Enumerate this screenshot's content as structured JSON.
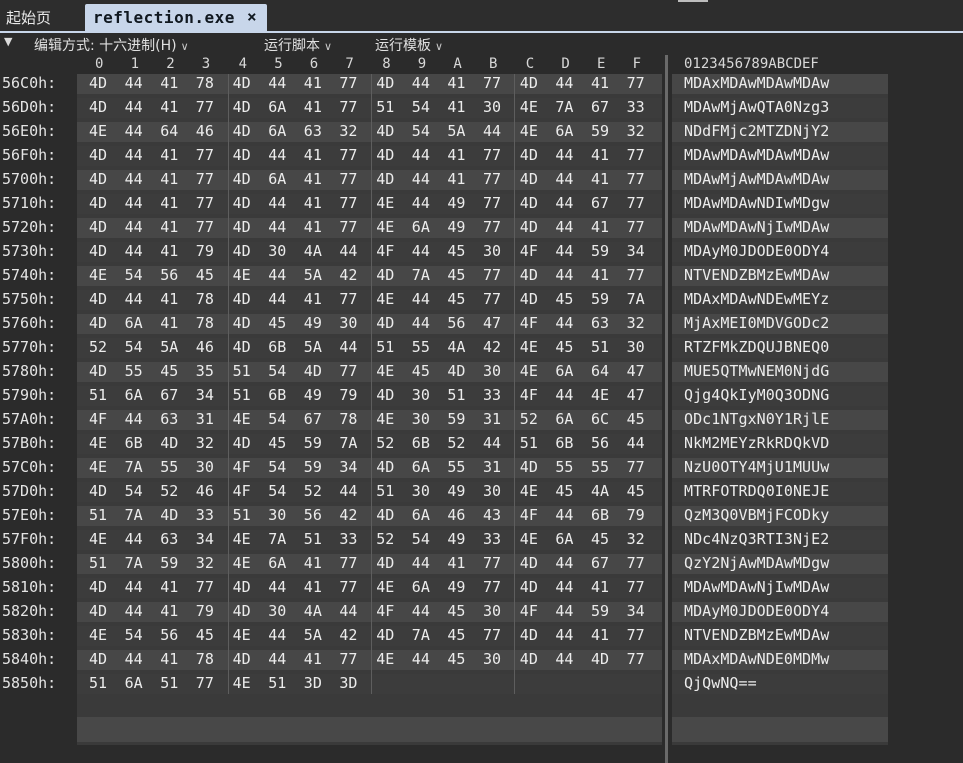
{
  "tabs": {
    "home_label": "起始页",
    "active_title": "reflection.exe",
    "close_glyph": "×"
  },
  "toolbar": {
    "collapse_glyph": "▼",
    "edit_mode_label": "编辑方式: 十六进制(H)",
    "run_script_label": "运行脚本",
    "run_template_label": "运行模板",
    "chevron_glyph": "∨"
  },
  "columns": {
    "hex_headers": [
      "0",
      "1",
      "2",
      "3",
      "4",
      "5",
      "6",
      "7",
      "8",
      "9",
      "A",
      "B",
      "C",
      "D",
      "E",
      "F"
    ],
    "ascii_header": "0123456789ABCDEF"
  },
  "rows": [
    {
      "addr": "56C0h:",
      "bytes": [
        "4D",
        "44",
        "41",
        "78",
        "4D",
        "44",
        "41",
        "77",
        "4D",
        "44",
        "41",
        "77",
        "4D",
        "44",
        "41",
        "77"
      ],
      "ascii": "MDAxMDAwMDAwMDAw"
    },
    {
      "addr": "56D0h:",
      "bytes": [
        "4D",
        "44",
        "41",
        "77",
        "4D",
        "6A",
        "41",
        "77",
        "51",
        "54",
        "41",
        "30",
        "4E",
        "7A",
        "67",
        "33"
      ],
      "ascii": "MDAwMjAwQTA0Nzg3"
    },
    {
      "addr": "56E0h:",
      "bytes": [
        "4E",
        "44",
        "64",
        "46",
        "4D",
        "6A",
        "63",
        "32",
        "4D",
        "54",
        "5A",
        "44",
        "4E",
        "6A",
        "59",
        "32"
      ],
      "ascii": "NDdFMjc2MTZDNjY2"
    },
    {
      "addr": "56F0h:",
      "bytes": [
        "4D",
        "44",
        "41",
        "77",
        "4D",
        "44",
        "41",
        "77",
        "4D",
        "44",
        "41",
        "77",
        "4D",
        "44",
        "41",
        "77"
      ],
      "ascii": "MDAwMDAwMDAwMDAw"
    },
    {
      "addr": "5700h:",
      "bytes": [
        "4D",
        "44",
        "41",
        "77",
        "4D",
        "6A",
        "41",
        "77",
        "4D",
        "44",
        "41",
        "77",
        "4D",
        "44",
        "41",
        "77"
      ],
      "ascii": "MDAwMjAwMDAwMDAw"
    },
    {
      "addr": "5710h:",
      "bytes": [
        "4D",
        "44",
        "41",
        "77",
        "4D",
        "44",
        "41",
        "77",
        "4E",
        "44",
        "49",
        "77",
        "4D",
        "44",
        "67",
        "77"
      ],
      "ascii": "MDAwMDAwNDIwMDgw"
    },
    {
      "addr": "5720h:",
      "bytes": [
        "4D",
        "44",
        "41",
        "77",
        "4D",
        "44",
        "41",
        "77",
        "4E",
        "6A",
        "49",
        "77",
        "4D",
        "44",
        "41",
        "77"
      ],
      "ascii": "MDAwMDAwNjIwMDAw"
    },
    {
      "addr": "5730h:",
      "bytes": [
        "4D",
        "44",
        "41",
        "79",
        "4D",
        "30",
        "4A",
        "44",
        "4F",
        "44",
        "45",
        "30",
        "4F",
        "44",
        "59",
        "34"
      ],
      "ascii": "MDAyM0JDODE0ODY4"
    },
    {
      "addr": "5740h:",
      "bytes": [
        "4E",
        "54",
        "56",
        "45",
        "4E",
        "44",
        "5A",
        "42",
        "4D",
        "7A",
        "45",
        "77",
        "4D",
        "44",
        "41",
        "77"
      ],
      "ascii": "NTVENDZBMzEwMDAw"
    },
    {
      "addr": "5750h:",
      "bytes": [
        "4D",
        "44",
        "41",
        "78",
        "4D",
        "44",
        "41",
        "77",
        "4E",
        "44",
        "45",
        "77",
        "4D",
        "45",
        "59",
        "7A"
      ],
      "ascii": "MDAxMDAwNDEwMEYz"
    },
    {
      "addr": "5760h:",
      "bytes": [
        "4D",
        "6A",
        "41",
        "78",
        "4D",
        "45",
        "49",
        "30",
        "4D",
        "44",
        "56",
        "47",
        "4F",
        "44",
        "63",
        "32"
      ],
      "ascii": "MjAxMEI0MDVGODc2"
    },
    {
      "addr": "5770h:",
      "bytes": [
        "52",
        "54",
        "5A",
        "46",
        "4D",
        "6B",
        "5A",
        "44",
        "51",
        "55",
        "4A",
        "42",
        "4E",
        "45",
        "51",
        "30"
      ],
      "ascii": "RTZFMkZDQUJBNEQ0"
    },
    {
      "addr": "5780h:",
      "bytes": [
        "4D",
        "55",
        "45",
        "35",
        "51",
        "54",
        "4D",
        "77",
        "4E",
        "45",
        "4D",
        "30",
        "4E",
        "6A",
        "64",
        "47"
      ],
      "ascii": "MUE5QTMwNEM0NjdG"
    },
    {
      "addr": "5790h:",
      "bytes": [
        "51",
        "6A",
        "67",
        "34",
        "51",
        "6B",
        "49",
        "79",
        "4D",
        "30",
        "51",
        "33",
        "4F",
        "44",
        "4E",
        "47"
      ],
      "ascii": "Qjg4QkIyM0Q3ODNG"
    },
    {
      "addr": "57A0h:",
      "bytes": [
        "4F",
        "44",
        "63",
        "31",
        "4E",
        "54",
        "67",
        "78",
        "4E",
        "30",
        "59",
        "31",
        "52",
        "6A",
        "6C",
        "45"
      ],
      "ascii": "ODc1NTgxN0Y1RjlE"
    },
    {
      "addr": "57B0h:",
      "bytes": [
        "4E",
        "6B",
        "4D",
        "32",
        "4D",
        "45",
        "59",
        "7A",
        "52",
        "6B",
        "52",
        "44",
        "51",
        "6B",
        "56",
        "44"
      ],
      "ascii": "NkM2MEYzRkRDQkVD"
    },
    {
      "addr": "57C0h:",
      "bytes": [
        "4E",
        "7A",
        "55",
        "30",
        "4F",
        "54",
        "59",
        "34",
        "4D",
        "6A",
        "55",
        "31",
        "4D",
        "55",
        "55",
        "77"
      ],
      "ascii": "NzU0OTY4MjU1MUUw"
    },
    {
      "addr": "57D0h:",
      "bytes": [
        "4D",
        "54",
        "52",
        "46",
        "4F",
        "54",
        "52",
        "44",
        "51",
        "30",
        "49",
        "30",
        "4E",
        "45",
        "4A",
        "45"
      ],
      "ascii": "MTRFOTRDQ0I0NEJE"
    },
    {
      "addr": "57E0h:",
      "bytes": [
        "51",
        "7A",
        "4D",
        "33",
        "51",
        "30",
        "56",
        "42",
        "4D",
        "6A",
        "46",
        "43",
        "4F",
        "44",
        "6B",
        "79"
      ],
      "ascii": "QzM3Q0VBMjFCODky"
    },
    {
      "addr": "57F0h:",
      "bytes": [
        "4E",
        "44",
        "63",
        "34",
        "4E",
        "7A",
        "51",
        "33",
        "52",
        "54",
        "49",
        "33",
        "4E",
        "6A",
        "45",
        "32"
      ],
      "ascii": "NDc4NzQ3RTI3NjE2"
    },
    {
      "addr": "5800h:",
      "bytes": [
        "51",
        "7A",
        "59",
        "32",
        "4E",
        "6A",
        "41",
        "77",
        "4D",
        "44",
        "41",
        "77",
        "4D",
        "44",
        "67",
        "77"
      ],
      "ascii": "QzY2NjAwMDAwMDgw"
    },
    {
      "addr": "5810h:",
      "bytes": [
        "4D",
        "44",
        "41",
        "77",
        "4D",
        "44",
        "41",
        "77",
        "4E",
        "6A",
        "49",
        "77",
        "4D",
        "44",
        "41",
        "77"
      ],
      "ascii": "MDAwMDAwNjIwMDAw"
    },
    {
      "addr": "5820h:",
      "bytes": [
        "4D",
        "44",
        "41",
        "79",
        "4D",
        "30",
        "4A",
        "44",
        "4F",
        "44",
        "45",
        "30",
        "4F",
        "44",
        "59",
        "34"
      ],
      "ascii": "MDAyM0JDODE0ODY4"
    },
    {
      "addr": "5830h:",
      "bytes": [
        "4E",
        "54",
        "56",
        "45",
        "4E",
        "44",
        "5A",
        "42",
        "4D",
        "7A",
        "45",
        "77",
        "4D",
        "44",
        "41",
        "77"
      ],
      "ascii": "NTVENDZBMzEwMDAw"
    },
    {
      "addr": "5840h:",
      "bytes": [
        "4D",
        "44",
        "41",
        "78",
        "4D",
        "44",
        "41",
        "77",
        "4E",
        "44",
        "45",
        "30",
        "4D",
        "44",
        "4D",
        "77"
      ],
      "ascii": "MDAxMDAwNDE0MDMw"
    },
    {
      "addr": "5850h:",
      "bytes": [
        "51",
        "6A",
        "51",
        "77",
        "4E",
        "51",
        "3D",
        "3D"
      ],
      "ascii": "QjQwNQ=="
    }
  ]
}
